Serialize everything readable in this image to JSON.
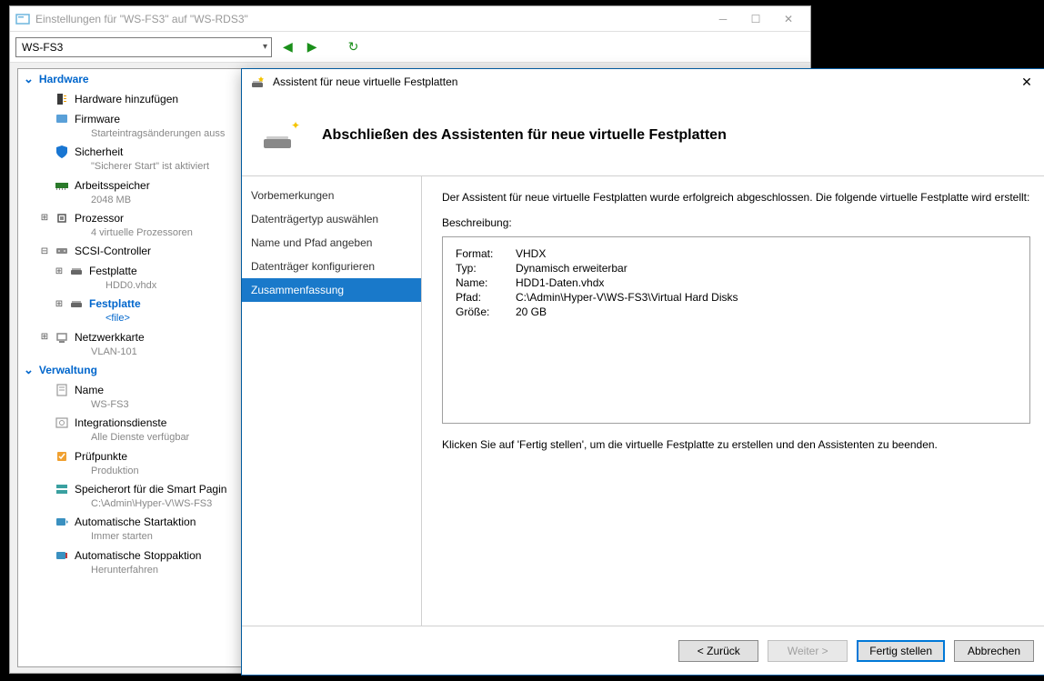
{
  "settings": {
    "window_title": "Einstellungen für \"WS-FS3\" auf \"WS-RDS3\"",
    "dropdown_value": "WS-FS3",
    "tree": {
      "hardware_header": "Hardware",
      "verwaltung_header": "Verwaltung",
      "items": [
        {
          "label": "Hardware hinzufügen"
        },
        {
          "label": "Firmware",
          "sub": "Starteintragsänderungen auss"
        },
        {
          "label": "Sicherheit",
          "sub": "\"Sicherer Start\" ist aktiviert"
        },
        {
          "label": "Arbeitsspeicher",
          "sub": "2048 MB"
        },
        {
          "label": "Prozessor",
          "sub": "4 virtuelle Prozessoren"
        },
        {
          "label": "SCSI-Controller"
        },
        {
          "label": "Festplatte",
          "sub": "HDD0.vhdx"
        },
        {
          "label": "Festplatte",
          "sub": "<file>"
        },
        {
          "label": "Netzwerkkarte",
          "sub": "VLAN-101"
        },
        {
          "label": "Name",
          "sub": "WS-FS3"
        },
        {
          "label": "Integrationsdienste",
          "sub": "Alle Dienste verfügbar"
        },
        {
          "label": "Prüfpunkte",
          "sub": "Produktion"
        },
        {
          "label": "Speicherort für die Smart Pagin",
          "sub": "C:\\Admin\\Hyper-V\\WS-FS3"
        },
        {
          "label": "Automatische Startaktion",
          "sub": "Immer starten"
        },
        {
          "label": "Automatische Stoppaktion",
          "sub": "Herunterfahren"
        }
      ]
    }
  },
  "wizard": {
    "title": "Assistent für neue virtuelle Festplatten",
    "header": "Abschließen des Assistenten für neue virtuelle Festplatten",
    "steps": [
      "Vorbemerkungen",
      "Datenträgertyp auswählen",
      "Name und Pfad angeben",
      "Datenträger konfigurieren",
      "Zusammenfassung"
    ],
    "intro": "Der Assistent für neue virtuelle Festplatten wurde erfolgreich abgeschlossen. Die folgende virtuelle Festplatte wird erstellt:",
    "desc_label": "Beschreibung:",
    "summary": {
      "format_k": "Format:",
      "format_v": "VHDX",
      "typ_k": "Typ:",
      "typ_v": "Dynamisch erweiterbar",
      "name_k": "Name:",
      "name_v": "HDD1-Daten.vhdx",
      "pfad_k": "Pfad:",
      "pfad_v": "C:\\Admin\\Hyper-V\\WS-FS3\\Virtual Hard Disks",
      "groesse_k": "Größe:",
      "groesse_v": "20 GB"
    },
    "finish_text": "Klicken Sie auf 'Fertig stellen', um die virtuelle Festplatte zu erstellen und den Assistenten zu beenden.",
    "buttons": {
      "back": "< Zurück",
      "next": "Weiter >",
      "finish": "Fertig stellen",
      "cancel": "Abbrechen"
    }
  }
}
